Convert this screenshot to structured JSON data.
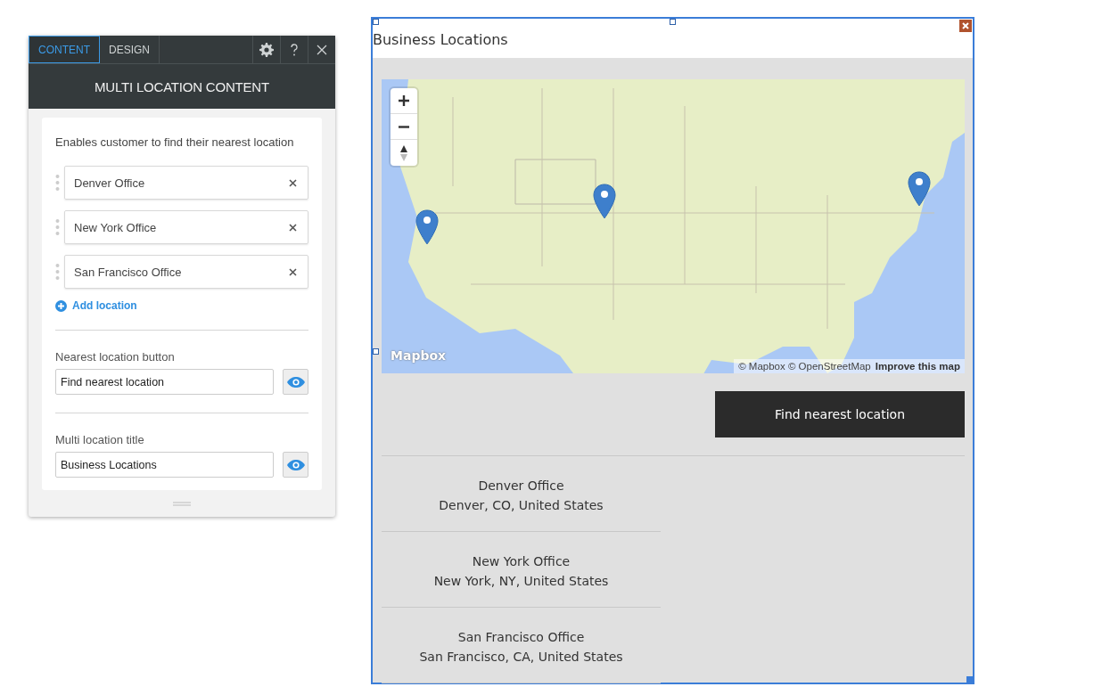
{
  "panel": {
    "tabs": [
      {
        "label": "CONTENT",
        "selected": true
      },
      {
        "label": "DESIGN",
        "selected": false
      }
    ],
    "title": "MULTI LOCATION CONTENT",
    "description": "Enables customer to find their nearest location",
    "locations": [
      {
        "name": "Denver Office"
      },
      {
        "name": "New York Office"
      },
      {
        "name": "San Francisco Office"
      }
    ],
    "add_label": "Add location",
    "fields": [
      {
        "label": "Nearest location button",
        "value": "Find nearest location",
        "visible": true
      },
      {
        "label": "Multi location title",
        "value": "Business Locations",
        "visible": true
      }
    ]
  },
  "widget": {
    "title": "Business Locations",
    "map": {
      "kind": "picture",
      "logo": "Mapbox",
      "attribution": "© Mapbox © OpenStreetMap",
      "improve_link": "Improve this map"
    },
    "button": "Find nearest location",
    "results": [
      {
        "name": "Denver Office",
        "address": "Denver, CO, United States"
      },
      {
        "name": "New York Office",
        "address": "New York, NY, United States"
      },
      {
        "name": "San Francisco Office",
        "address": "San Francisco, CA, United States"
      }
    ]
  }
}
